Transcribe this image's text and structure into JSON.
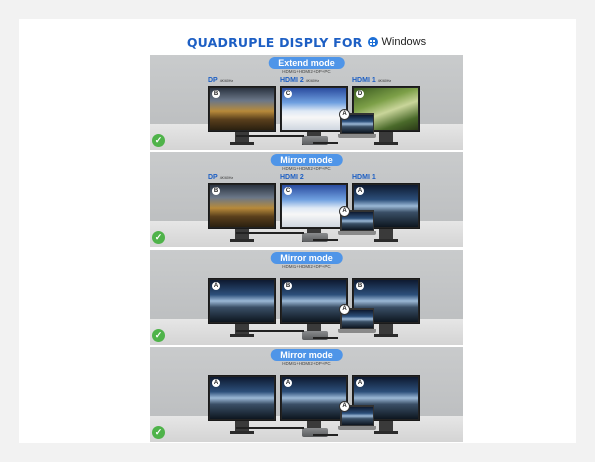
{
  "header": {
    "title": "QUADRUPLE DISPLY FOR",
    "os_label": "Windows"
  },
  "sections": [
    {
      "mode": "Extend mode",
      "subtitle": "HDMI1+HDMI2+DP+PC",
      "ports": [
        {
          "name": "DP",
          "spec": "4K/60Hz"
        },
        {
          "name": "HDMI 2",
          "spec": "4K/60Hz"
        },
        {
          "name": "HDMI 1",
          "spec": "4K/60Hz"
        }
      ],
      "monitors": [
        {
          "badge": "B",
          "scene": "forest"
        },
        {
          "badge": "C",
          "scene": "desert"
        },
        {
          "badge": "D",
          "scene": "warrior"
        }
      ],
      "laptop_badge": "A"
    },
    {
      "mode": "Mirror mode",
      "subtitle": "HDMI1+HDMI2+DP+PC",
      "ports": [
        {
          "name": "DP",
          "spec": "4K/60Hz"
        },
        {
          "name": "HDMI 2",
          "spec": ""
        },
        {
          "name": "HDMI 1",
          "spec": ""
        }
      ],
      "monitors": [
        {
          "badge": "B",
          "scene": "forest"
        },
        {
          "badge": "C",
          "scene": "desert"
        },
        {
          "badge": "A",
          "scene": "mount"
        }
      ],
      "laptop_badge": "A"
    },
    {
      "mode": "Mirror mode",
      "subtitle": "HDMI1+HDMI2+DP+PC",
      "ports": [],
      "monitors": [
        {
          "badge": "A",
          "scene": "mount"
        },
        {
          "badge": "B",
          "scene": "mount"
        },
        {
          "badge": "B",
          "scene": "mount"
        }
      ],
      "laptop_badge": "A"
    },
    {
      "mode": "Mirror mode",
      "subtitle": "HDMI1+HDMI2+DP+PC",
      "ports": [],
      "monitors": [
        {
          "badge": "A",
          "scene": "mount"
        },
        {
          "badge": "A",
          "scene": "mount"
        },
        {
          "badge": "A",
          "scene": "mount"
        }
      ],
      "laptop_badge": "A"
    }
  ],
  "check_glyph": "✓",
  "colors": {
    "accent": "#1d5fc4",
    "pill": "#4f95e8",
    "check": "#4fb34a"
  }
}
